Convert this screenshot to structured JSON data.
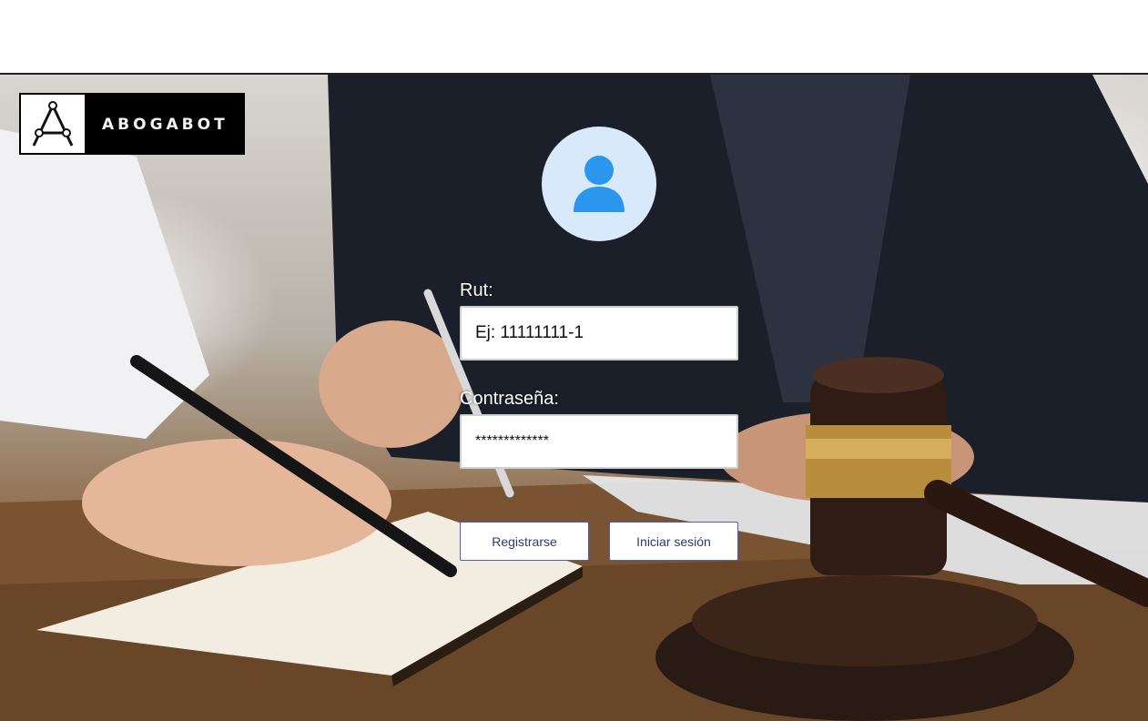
{
  "brand": {
    "name": "ABOGABOT"
  },
  "login": {
    "avatar_icon": "user-icon",
    "rut_label": "Rut:",
    "rut_placeholder": "Ej: 11111111-1",
    "password_label": "Contraseña:",
    "password_value": "*************",
    "register_label": "Registrarse",
    "login_label": "Iniciar sesión"
  },
  "colors": {
    "avatar_bg": "#d7e9fb",
    "avatar_icon": "#2b96ee",
    "button_border": "#4a5fbf"
  }
}
